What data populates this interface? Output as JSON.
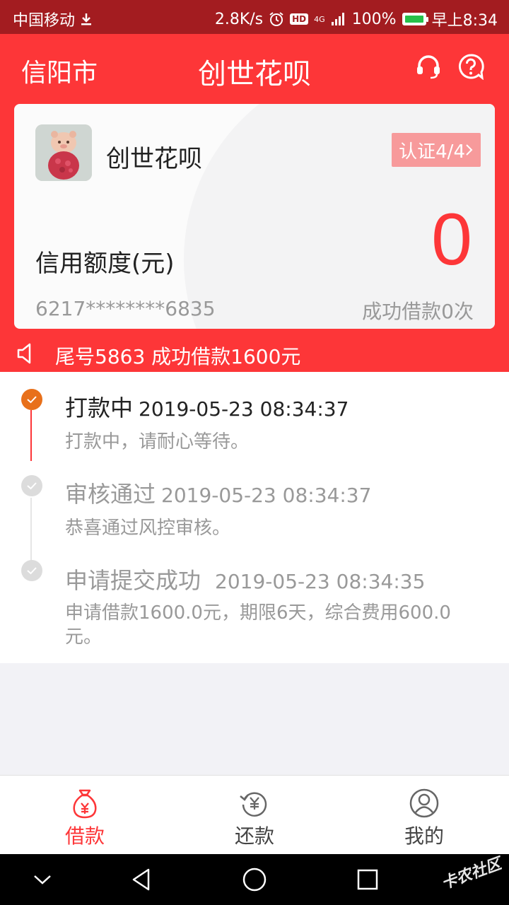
{
  "status_bar": {
    "carrier": "中国移动",
    "speed": "2.8K/s",
    "hd": "HD",
    "network": "4G",
    "battery": "100%",
    "battery_level": 1.0,
    "time": "早上8:34"
  },
  "header": {
    "city": "信阳市",
    "title": "创世花呗",
    "icons": [
      "headset-icon",
      "help-icon"
    ]
  },
  "card": {
    "app_name": "创世花呗",
    "verify_label": "认证4/4",
    "limit_label": "信用额度(元)",
    "limit_value": "0",
    "card_number": "6217********6835",
    "success_count": "成功借款0次"
  },
  "notice": {
    "text": "尾号5863 成功借款1600元"
  },
  "timeline": [
    {
      "title": "打款中",
      "time": "2019-05-23 08:34:37",
      "desc": "打款中，请耐心等待。",
      "state": "active"
    },
    {
      "title": "审核通过",
      "time": "2019-05-23 08:34:37",
      "desc": "恭喜通过风控审核。",
      "state": "done"
    },
    {
      "title": "申请提交成功",
      "time": "2019-05-23 08:34:35",
      "desc": "申请借款1600.0元，期限6天，综合费用600.0元。",
      "state": "done"
    }
  ],
  "tabs": [
    {
      "label": "借款",
      "icon": "money-bag-icon",
      "active": true
    },
    {
      "label": "还款",
      "icon": "repay-icon",
      "active": false
    },
    {
      "label": "我的",
      "icon": "profile-icon",
      "active": false
    }
  ],
  "colors": {
    "brand_red": "#fd3638",
    "status_bar": "#a31c20",
    "active_dot": "#e8701a"
  },
  "watermark": "卡农社区"
}
